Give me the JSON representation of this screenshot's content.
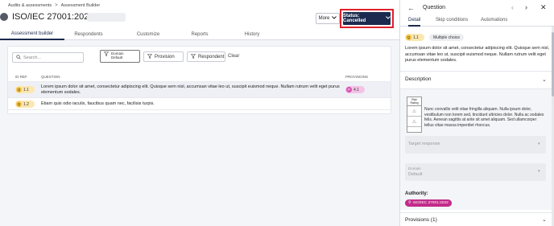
{
  "breadcrumb": {
    "parent": "Audits & assessments",
    "separator": ">",
    "current": "Assessment Builder"
  },
  "header": {
    "title": "ISO/IEC 27001:2022 Qs V1",
    "more_label": "More",
    "status_label": "Status: Cancelled"
  },
  "tabs": [
    {
      "label": "Assessment builder"
    },
    {
      "label": "Respondents"
    },
    {
      "label": "Customize"
    },
    {
      "label": "Reports"
    },
    {
      "label": "History"
    }
  ],
  "filters": {
    "search_placeholder": "Search...",
    "domain_label": "Domain",
    "domain_value": "Default",
    "provision_label": "Provision",
    "respondent_label": "Respondent",
    "clear_label": "Clear"
  },
  "table": {
    "columns": [
      "ID REF",
      "QUESTION",
      "PROVISIONS"
    ],
    "rows": [
      {
        "badge_letter": "Q",
        "ref": "1.1",
        "question_line1": "Lorem ipsum dolor sit amet, consectetur adipiscing elit. Quisque sem nisl, accumsan vitae leo ut, suscipit euismod neque. Nullam rutrum velit eget purus",
        "question_line2": "elementum sodales.",
        "provision_letter": "P",
        "provision_ref": "4.1"
      },
      {
        "badge_letter": "Q",
        "ref": "1.2",
        "question_line1": "Etiam quis odio iaculis, faucibus quam nec, facilisis turpis."
      }
    ]
  },
  "panel": {
    "title": "Question",
    "tabs": [
      "Detail",
      "Skip conditions",
      "Automations"
    ],
    "badge_letter": "Q",
    "ref": "1.1",
    "type": "Multiple choice",
    "question_text": "Lorem ipsum dolor sit amet, consectetur adipiscing elit. Quisque sem nisl, accumsan vitae leo ut, suscipit euismod neque. Nullam rutrum velit eget purus elementum sodales.",
    "description_label": "Description",
    "risk_rating_header": "Risk Rating",
    "description_text": "Nunc convallis velit vitae fringilla aliquam. Nulla ipsum dolor, vestibulum non lorem sed, tincidunt ultricies dolor. Nulla ac sodales felis. Aenean sagittis at ante sit amet aliquam. Sed ullamcorper tellus vitae massa imperdiet rhoncus.",
    "target_response_label": "Target response",
    "domain_label": "Domain",
    "domain_value": "Default",
    "authority_label": "Authority:",
    "authority_tag": "ISO/IEC 27001:2022",
    "provisions_label": "Provisions (1)"
  }
}
